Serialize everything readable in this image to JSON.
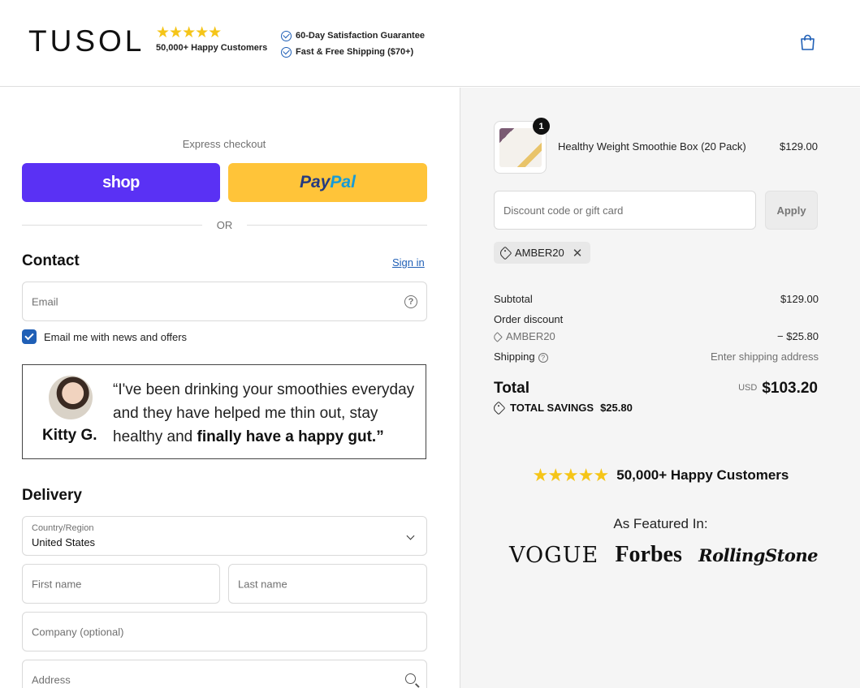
{
  "header": {
    "brand": "TUSOL",
    "stars": "★★★★★",
    "happy_customers": "50,000+ Happy Customers",
    "guarantee_1": "60-Day Satisfaction Guarantee",
    "guarantee_2": "Fast & Free Shipping ($70+)"
  },
  "express": {
    "label": "Express checkout",
    "shop_label": "shop",
    "paypal_1": "Pay",
    "paypal_2": "Pal",
    "or_label": "OR"
  },
  "contact": {
    "title": "Contact",
    "signin_label": "Sign in",
    "email_placeholder": "Email",
    "news_label": "Email me with news and offers",
    "news_checked": true
  },
  "testimonial": {
    "name": "Kitty G.",
    "quote_plain": "“I've been drinking your smoothies everyday and they have helped me thin out, stay healthy and ",
    "quote_bold": "finally have a happy gut.”"
  },
  "delivery": {
    "title": "Delivery",
    "country_label": "Country/Region",
    "country_value": "United States",
    "first_name_placeholder": "First name",
    "last_name_placeholder": "Last name",
    "company_placeholder": "Company (optional)",
    "address_placeholder": "Address"
  },
  "order": {
    "quantity": "1",
    "product_name": "Healthy Weight Smoothie Box (20 Pack)",
    "product_price": "$129.00",
    "discount_placeholder": "Discount code or gift card",
    "apply_label": "Apply",
    "applied_code": "AMBER20",
    "subtotal_label": "Subtotal",
    "subtotal_value": "$129.00",
    "order_discount_label": "Order discount",
    "discount_code": "AMBER20",
    "discount_value": "− $25.80",
    "shipping_label": "Shipping",
    "shipping_value": "Enter shipping address",
    "total_label": "Total",
    "currency": "USD",
    "total_value": "$103.20",
    "savings_label": "TOTAL SAVINGS",
    "savings_value": "$25.80"
  },
  "social_proof": {
    "stars": "★★★★★",
    "happy_customers": "50,000+ Happy Customers",
    "featured_label": "As Featured In:",
    "publications": [
      "VOGUE",
      "Forbes",
      "RollingStone"
    ]
  },
  "colors": {
    "shop_purple": "#5a31f4",
    "paypal_yellow": "#ffc439",
    "link_blue": "#1f5fb6",
    "star_gold": "#f5c518"
  }
}
